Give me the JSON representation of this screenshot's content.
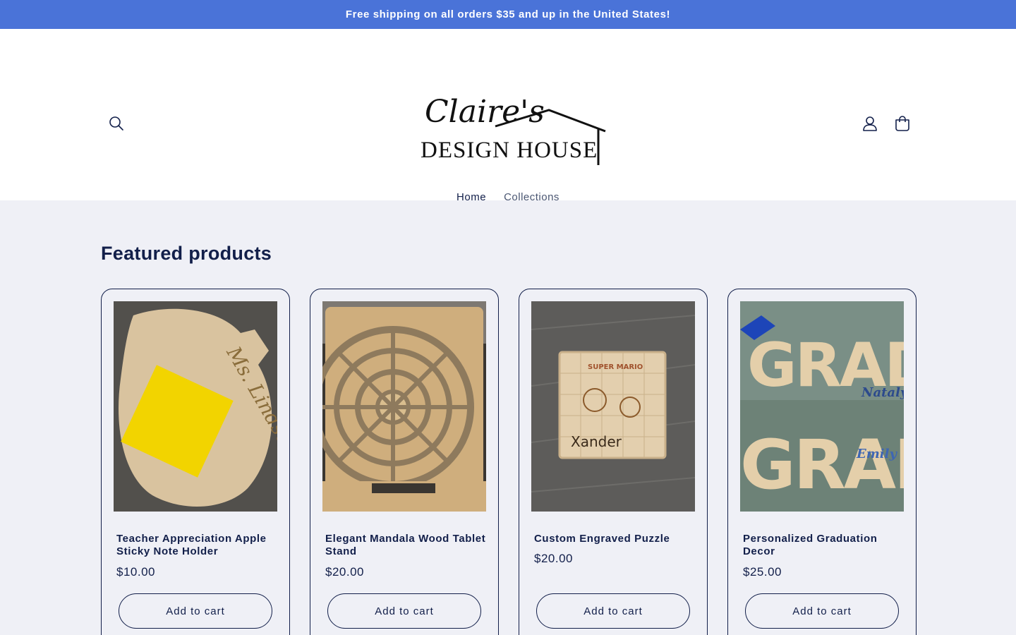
{
  "announcement": {
    "text": "Free shipping on all orders $35 and up in the United States!"
  },
  "header": {
    "logo_script": "Claire's",
    "logo_caps": "DESIGN HOUSE",
    "nav": [
      {
        "label": "Home",
        "active": true
      },
      {
        "label": "Collections",
        "active": false
      }
    ]
  },
  "featured": {
    "heading": "Featured products",
    "products": [
      {
        "title": "Teacher Appreciation Apple Sticky Note Holder",
        "price": "$10.00",
        "button": "Add to cart",
        "image_text": "Ms. Lindsey"
      },
      {
        "title": "Elegant Mandala Wood Tablet Stand",
        "price": "$20.00",
        "button": "Add to cart"
      },
      {
        "title": "Custom Engraved Puzzle",
        "price": "$20.00",
        "button": "Add to cart",
        "image_text": "Xander",
        "image_text_2": "SUPER MARIO"
      },
      {
        "title": "Personalized Graduation Decor",
        "price": "$25.00",
        "button": "Add to cart",
        "image_text": "GRAD",
        "image_name_1": "Nataly",
        "image_name_2": "Emily"
      }
    ]
  },
  "colors": {
    "announcement_bg": "#4a73d8",
    "text": "#121f4a",
    "section_bg": "#eff0f6"
  },
  "icons": [
    "search-icon",
    "account-icon",
    "cart-icon"
  ]
}
